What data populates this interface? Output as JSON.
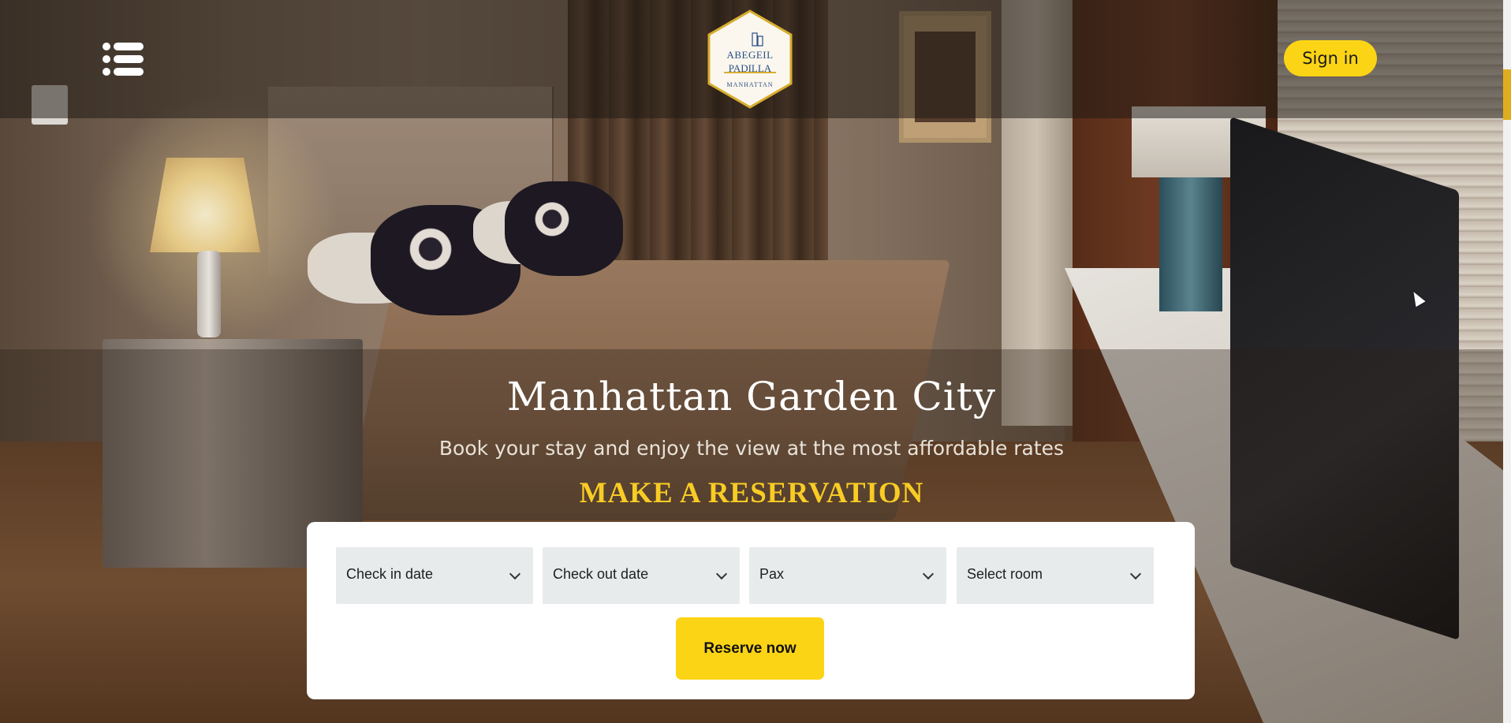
{
  "header": {
    "menu_icon": "list-menu-icon",
    "logo": {
      "line1": "ABEGEIL",
      "line2": "PADILLA",
      "line3": "MANHATTAN"
    },
    "signin_label": "Sign in"
  },
  "hero": {
    "title": "Manhattan Garden City",
    "subtitle": "Book your stay and enjoy the view at the most affordable rates",
    "reservation_heading": "MAKE A RESERVATION"
  },
  "reservation": {
    "fields": [
      {
        "label": "Check in date"
      },
      {
        "label": "Check out date"
      },
      {
        "label": "Pax"
      },
      {
        "label": "Select room"
      }
    ],
    "submit_label": "Reserve now"
  },
  "colors": {
    "accent": "#fcd416",
    "heading_accent": "#f8cc24",
    "panel": "#ffffff",
    "field_bg": "#e8ebec"
  }
}
